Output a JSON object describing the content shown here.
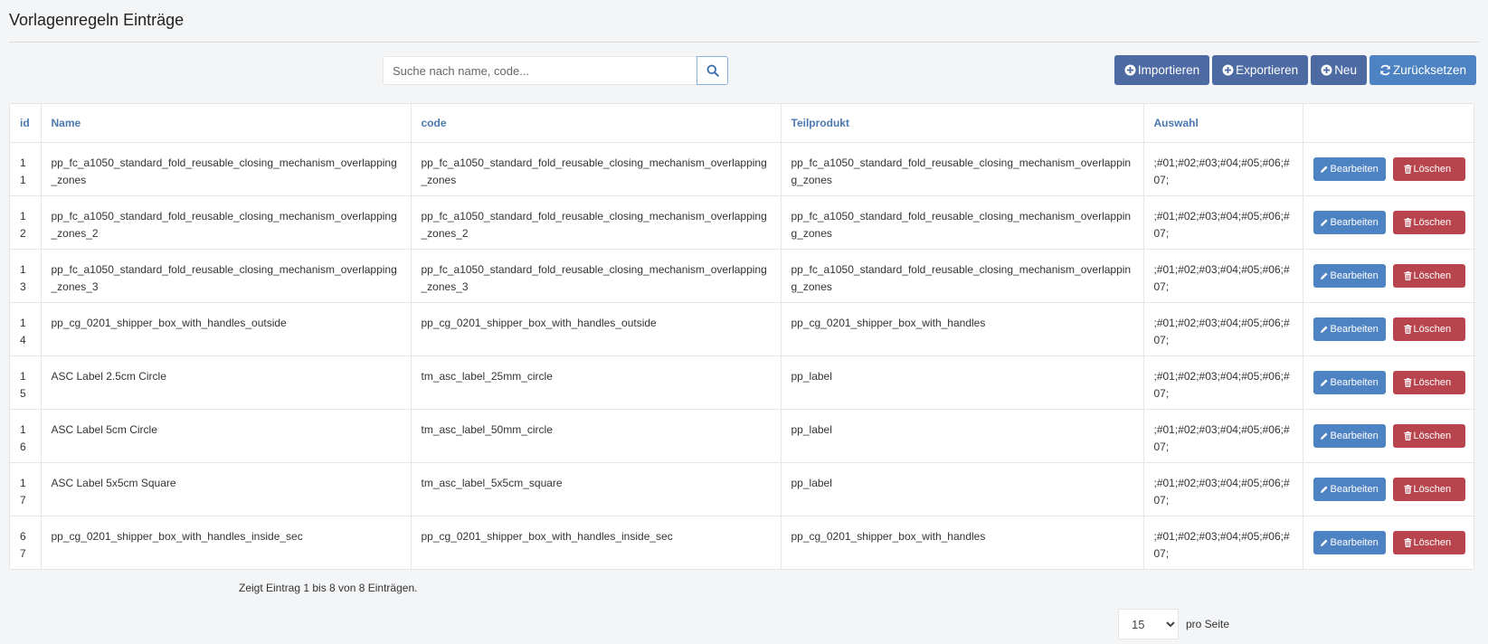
{
  "page": {
    "title": "Vorlagenregeln Einträge"
  },
  "search": {
    "placeholder": "Suche nach name, code...",
    "value": ""
  },
  "toolbar": {
    "import_label": "Importieren",
    "export_label": "Exportieren",
    "new_label": "Neu",
    "reset_label": "Zurücksetzen"
  },
  "table": {
    "columns": [
      "id",
      "Name",
      "code",
      "Teilprodukt",
      "Auswahl",
      ""
    ],
    "rows": [
      {
        "id": "11",
        "name": "pp_fc_a1050_standard_fold_reusable_closing_mechanism_overlapping_zones",
        "code": "pp_fc_a1050_standard_fold_reusable_closing_mechanism_overlapping_zones",
        "teilprodukt": "pp_fc_a1050_standard_fold_reusable_closing_mechanism_overlapping_zones",
        "auswahl": ";#01;#02;#03;#04;#05;#06;#07;"
      },
      {
        "id": "12",
        "name": "pp_fc_a1050_standard_fold_reusable_closing_mechanism_overlapping_zones_2",
        "code": "pp_fc_a1050_standard_fold_reusable_closing_mechanism_overlapping_zones_2",
        "teilprodukt": "pp_fc_a1050_standard_fold_reusable_closing_mechanism_overlapping_zones",
        "auswahl": ";#01;#02;#03;#04;#05;#06;#07;"
      },
      {
        "id": "13",
        "name": "pp_fc_a1050_standard_fold_reusable_closing_mechanism_overlapping_zones_3",
        "code": "pp_fc_a1050_standard_fold_reusable_closing_mechanism_overlapping_zones_3",
        "teilprodukt": "pp_fc_a1050_standard_fold_reusable_closing_mechanism_overlapping_zones",
        "auswahl": ";#01;#02;#03;#04;#05;#06;#07;"
      },
      {
        "id": "14",
        "name": "pp_cg_0201_shipper_box_with_handles_outside",
        "code": "pp_cg_0201_shipper_box_with_handles_outside",
        "teilprodukt": "pp_cg_0201_shipper_box_with_handles",
        "auswahl": ";#01;#02;#03;#04;#05;#06;#07;"
      },
      {
        "id": "15",
        "name": "ASC Label 2.5cm Circle",
        "code": "tm_asc_label_25mm_circle",
        "teilprodukt": "pp_label",
        "auswahl": ";#01;#02;#03;#04;#05;#06;#07;"
      },
      {
        "id": "16",
        "name": "ASC Label 5cm Circle",
        "code": "tm_asc_label_50mm_circle",
        "teilprodukt": "pp_label",
        "auswahl": ";#01;#02;#03;#04;#05;#06;#07;"
      },
      {
        "id": "17",
        "name": "ASC Label 5x5cm Square",
        "code": "tm_asc_label_5x5cm_square",
        "teilprodukt": "pp_label",
        "auswahl": ";#01;#02;#03;#04;#05;#06;#07;"
      },
      {
        "id": "67",
        "name": "pp_cg_0201_shipper_box_with_handles_inside_sec",
        "code": "pp_cg_0201_shipper_box_with_handles_inside_sec",
        "teilprodukt": "pp_cg_0201_shipper_box_with_handles",
        "auswahl": ";#01;#02;#03;#04;#05;#06;#07;"
      }
    ],
    "edit_label": "Bearbeiten",
    "delete_label": "Löschen"
  },
  "footer": {
    "status": "Zeigt Eintrag 1 bis 8 von 8 Einträgen.",
    "per_page_value": "15",
    "per_page_options": [
      "15"
    ],
    "per_page_label": "pro Seite"
  },
  "colors": {
    "primary": "#4d6aa3",
    "edit": "#4d82c3",
    "delete": "#b8454e",
    "header_text": "#4a78b0"
  }
}
